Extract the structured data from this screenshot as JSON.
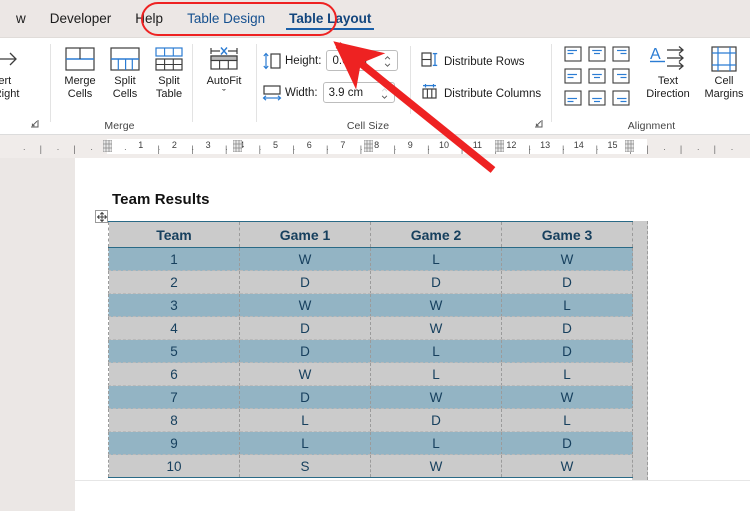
{
  "tabbar": {
    "tabs": [
      {
        "id": "view",
        "label": "w",
        "kind": "cut"
      },
      {
        "id": "developer",
        "label": "Developer",
        "kind": "normal"
      },
      {
        "id": "help",
        "label": "Help",
        "kind": "normal"
      },
      {
        "id": "table-design",
        "label": "Table Design",
        "kind": "context"
      },
      {
        "id": "table-layout",
        "label": "Table Layout",
        "kind": "context-active"
      }
    ],
    "highlight_color": "#ee2222"
  },
  "ribbon": {
    "groups": [
      {
        "id": "rows-columns",
        "label": ""
      },
      {
        "id": "merge",
        "label": "Merge"
      },
      {
        "id": "cell-size",
        "label": "Cell Size"
      },
      {
        "id": "alignment",
        "label": "Alignment"
      }
    ],
    "rows_columns": {
      "insert_button_label_line1": "sert",
      "insert_button_label_line2": "n Right"
    },
    "merge": {
      "group_label": "Merge",
      "buttons": [
        {
          "id": "merge-cells",
          "line1": "Merge",
          "line2": "Cells"
        },
        {
          "id": "split-cells",
          "line1": "Split",
          "line2": "Cells"
        },
        {
          "id": "split-table",
          "line1": "Split",
          "line2": "Table"
        }
      ],
      "autofit": {
        "line1": "AutoFit",
        "line2": "ˇ"
      }
    },
    "cell_size": {
      "group_label": "Cell Size",
      "height_label": "Height:",
      "height_value": "0.6 cm",
      "width_label": "Width:",
      "width_value": "3.9 cm",
      "distribute_rows": "Distribute Rows",
      "distribute_columns": "Distribute Columns"
    },
    "alignment": {
      "group_label": "Alignment",
      "text_direction_line1": "Text",
      "text_direction_line2": "Direction",
      "cell_margins_line1": "Cell",
      "cell_margins_line2": "Margins"
    }
  },
  "ruler": {
    "numbers": [
      "1",
      "2",
      "3",
      "4",
      "5",
      "6",
      "7",
      "8",
      "9",
      "10",
      "11",
      "12",
      "13",
      "14",
      "15"
    ]
  },
  "document": {
    "title": "Team Results",
    "table": {
      "headers": [
        "Team",
        "Game 1",
        "Game 2",
        "Game 3"
      ],
      "rows": [
        [
          "1",
          "W",
          "L",
          "W"
        ],
        [
          "2",
          "D",
          "D",
          "D"
        ],
        [
          "3",
          "W",
          "W",
          "L"
        ],
        [
          "4",
          "D",
          "W",
          "D"
        ],
        [
          "5",
          "D",
          "L",
          "D"
        ],
        [
          "6",
          "W",
          "L",
          "L"
        ],
        [
          "7",
          "D",
          "W",
          "W"
        ],
        [
          "8",
          "L",
          "D",
          "L"
        ],
        [
          "9",
          "L",
          "L",
          "D"
        ],
        [
          "10",
          "S",
          "W",
          "W"
        ]
      ],
      "band_color": "#93b4c4",
      "plain_color": "#cbcbcb",
      "text_color": "#17405e"
    }
  }
}
